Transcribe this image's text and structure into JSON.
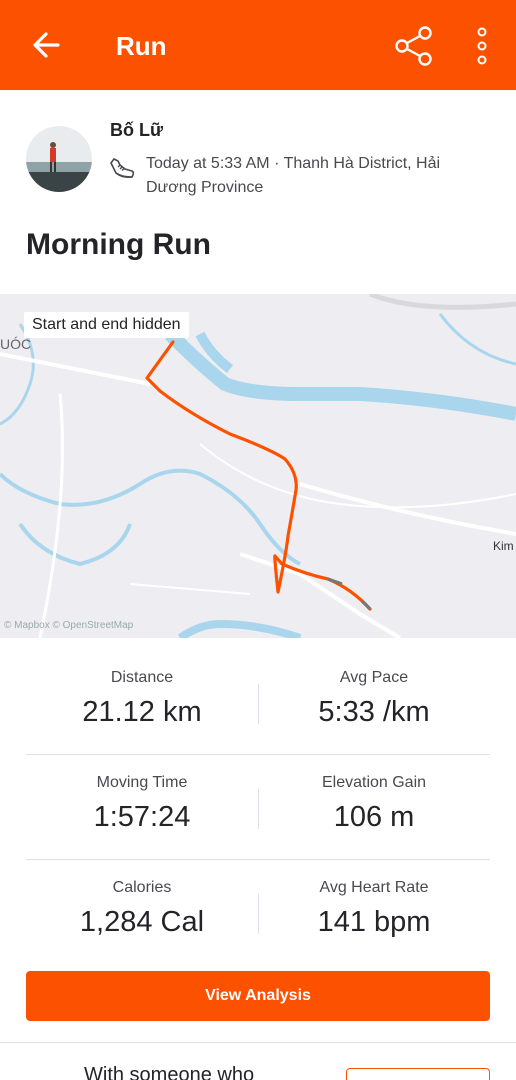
{
  "header": {
    "title": "Run",
    "back_icon": "arrow-left-icon",
    "share_icon": "share-icon",
    "more_icon": "more-vertical-icon",
    "color": "#fc5200"
  },
  "athlete": {
    "name": "Bố Lữ",
    "activity_icon": "running-shoe-icon",
    "meta": "Today at 5:33 AM · Thanh Hà District, Hải Dương Province"
  },
  "activity": {
    "title": "Morning Run"
  },
  "map": {
    "badge": "Start and end hidden",
    "label_left": "UÓC",
    "label_kim": "Kim",
    "attribution": "© Mapbox © OpenStreetMap",
    "route_color": "#fc5200"
  },
  "stats": [
    {
      "label": "Distance",
      "value": "21.12 km"
    },
    {
      "label": "Avg Pace",
      "value": "5:33 /km"
    },
    {
      "label": "Moving Time",
      "value": "1:57:24"
    },
    {
      "label": "Elevation Gain",
      "value": "106 m"
    },
    {
      "label": "Calories",
      "value": "1,284 Cal"
    },
    {
      "label": "Avg Heart Rate",
      "value": "141 bpm"
    }
  ],
  "actions": {
    "view_analysis": "View Analysis",
    "with_someone": "With someone who"
  }
}
